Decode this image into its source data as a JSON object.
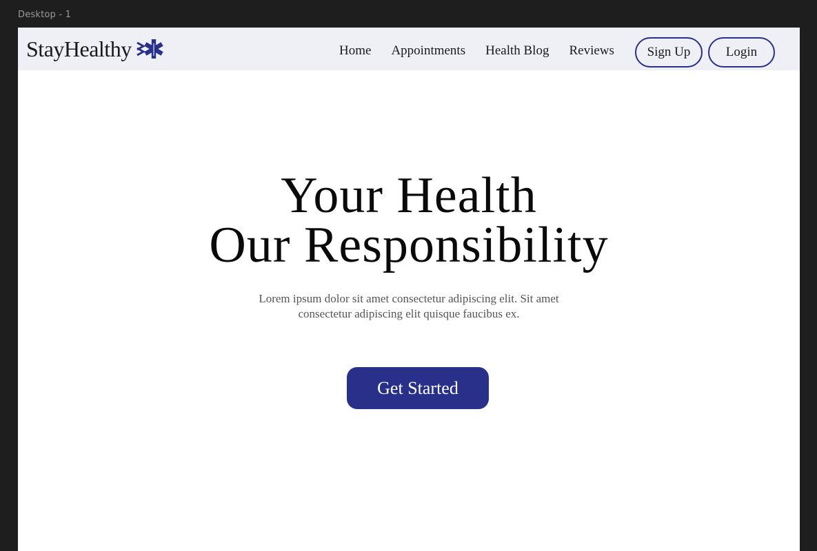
{
  "frame": {
    "label": "Desktop - 1"
  },
  "navbar": {
    "brand": "StayHealthy",
    "brand_icon": "medical-star-icon",
    "links": [
      "Home",
      "Appointments",
      "Health Blog",
      "Reviews"
    ],
    "signup_label": "Sign Up",
    "login_label": "Login"
  },
  "hero": {
    "title_line1": "Your Health",
    "title_line2": "Our Responsibility",
    "subtitle": "Lorem ipsum dolor sit amet consectetur adipiscing elit. Sit amet consectetur adipiscing elit quisque faucibus ex.",
    "cta_label": "Get Started"
  },
  "colors": {
    "accent": "#283089",
    "navbar_bg": "#eef0f5",
    "frame_bg": "#1e1e1e"
  }
}
